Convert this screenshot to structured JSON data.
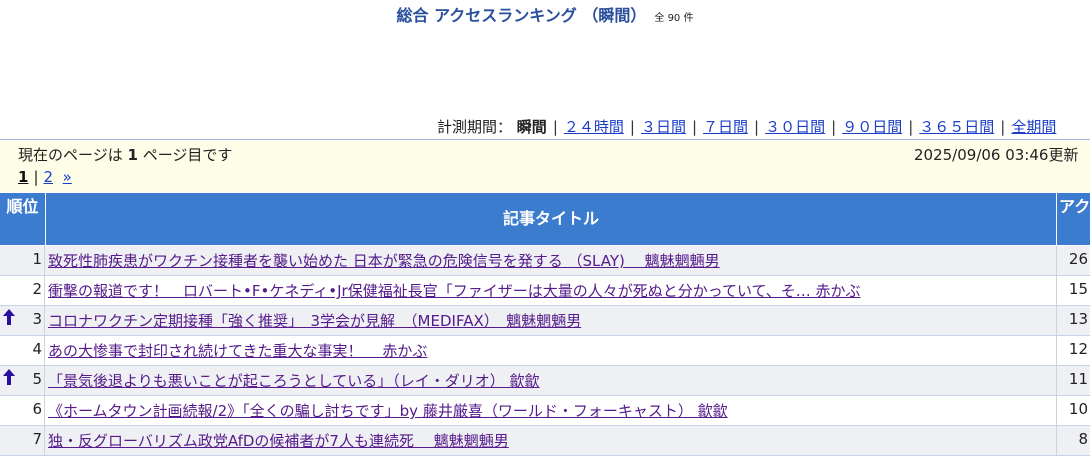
{
  "header": {
    "title": "総合 アクセスランキング （瞬間）",
    "count": "全 90 件"
  },
  "period": {
    "label": "計測期間：",
    "current": "瞬間",
    "links": [
      "２４時間",
      "３日間",
      "７日間",
      "３０日間",
      "９０日間",
      "３６５日間",
      "全期間"
    ]
  },
  "info": {
    "page_prefix": "現在のページは ",
    "page_number": "1",
    "page_suffix": " ページ目です",
    "updated": "2025/09/06 03:46更新"
  },
  "pager": {
    "current": "1",
    "next_page": "2",
    "next_symbol": "»"
  },
  "table": {
    "headers": {
      "rank": "順位",
      "title": "記事タイトル",
      "access": "アクセス"
    },
    "rows": [
      {
        "rank": "1",
        "up": false,
        "title": "致死性肺疾患がワクチン接種者を襲い始めた 日本が緊急の危険信号を発する （SLAY)　 魑魅魍魎男",
        "access": "26"
      },
      {
        "rank": "2",
        "up": false,
        "title": "衝撃の報道です！　ロバート•F•ケネディ•Jr保健福祉長官「ファイザーは大量の人々が死ぬと分かっていて、そ… 赤かぶ",
        "access": "15"
      },
      {
        "rank": "3",
        "up": true,
        "title": "コロナワクチン定期接種「強く推奨」　3学会が見解　（MEDIFAX）　魑魅魍魎男",
        "access": "13"
      },
      {
        "rank": "4",
        "up": false,
        "title": "あの大惨事で封印され続けてきた重大な事実！　 赤かぶ",
        "access": "12"
      },
      {
        "rank": "5",
        "up": true,
        "title": "「景気後退よりも悪いことが起ころうとしている」（レイ・ダリオ） 歙歙",
        "access": "11"
      },
      {
        "rank": "6",
        "up": false,
        "title": "《ホームタウン計画続報/2》「全くの騙し討ちです」by 藤井厳喜（ワールド・フォーキャスト） 歙歙",
        "access": "10"
      },
      {
        "rank": "7",
        "up": false,
        "title": "独・反グローバリズム政党AfDの候補者が7人も連続死　 魑魅魍魎男",
        "access": "8"
      }
    ]
  },
  "colors": {
    "header_bg": "#3c7ccf",
    "title_color": "#2a4f9c",
    "link_color": "#551a8b",
    "info_bg": "#fefde8",
    "arrow_color": "#2a0fa0"
  }
}
